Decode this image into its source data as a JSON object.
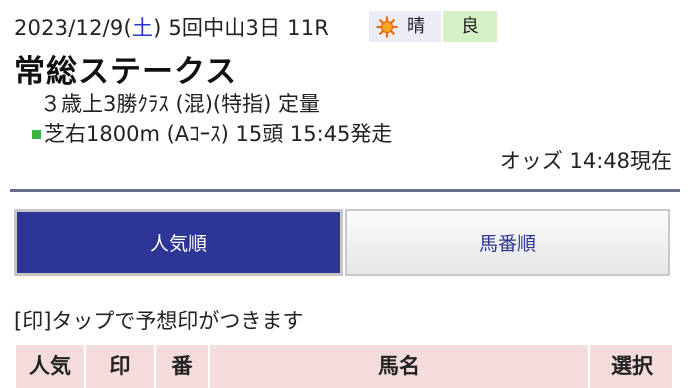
{
  "race": {
    "date_prefix": "2023/12/9(",
    "weekday": "土",
    "date_suffix": ") 5回中山3日 11R",
    "weather": "晴",
    "weather_icon": "sun-icon",
    "track_condition": "良",
    "name": "常総ステークス",
    "conditions": "３歳上3勝ｸﾗｽ (混)(特指) 定量",
    "course": "芝右1800m (Aｺｰｽ) 15頭 15:45発走",
    "course_color": "#3cb33c",
    "odds_time": "オッズ 14:48現在"
  },
  "tabs": [
    {
      "label": "人気順",
      "active": true
    },
    {
      "label": "馬番順",
      "active": false
    }
  ],
  "hint": "[印]タップで予想印がつきます",
  "table": {
    "headers": [
      "人気",
      "印",
      "番",
      "馬名",
      "選択"
    ]
  },
  "colors": {
    "accent": "#2d3696",
    "header_bg": "#f5dcdc",
    "weather_bg": "#ececf6",
    "track_bg": "#d5f0c5",
    "weekday": "#2a36c8"
  }
}
